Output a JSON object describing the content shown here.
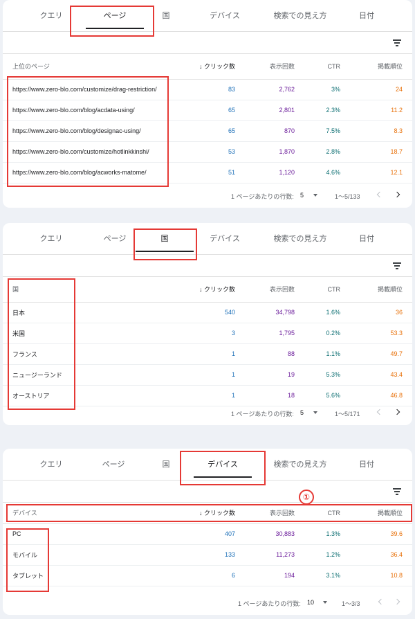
{
  "colors": {
    "accent_highlight": "#e53935",
    "clicks": "#1c6fb8",
    "impressions": "#6a1b9a",
    "ctr": "#0b6e72",
    "position": "#e8710a"
  },
  "panels": [
    {
      "tabs": [
        "クエリ",
        "ページ",
        "国",
        "デバイス",
        "検索での見え方",
        "日付"
      ],
      "active_tab": 1,
      "columns": [
        "上位のページ",
        "クリック数",
        "表示回数",
        "CTR",
        "掲載順位"
      ],
      "rows": [
        [
          "https://www.zero-blo.com/customize/drag-restriction/",
          "83",
          "2,762",
          "3%",
          "24"
        ],
        [
          "https://www.zero-blo.com/blog/acdata-using/",
          "65",
          "2,801",
          "2.3%",
          "11.2"
        ],
        [
          "https://www.zero-blo.com/blog/designac-using/",
          "65",
          "870",
          "7.5%",
          "8.3"
        ],
        [
          "https://www.zero-blo.com/customize/hotlinkkinshi/",
          "53",
          "1,870",
          "2.8%",
          "18.7"
        ],
        [
          "https://www.zero-blo.com/blog/acworks-matome/",
          "51",
          "1,120",
          "4.6%",
          "12.1"
        ]
      ],
      "pager": {
        "rows_label": "1 ページあたりの行数:",
        "rows_value": "5",
        "range": "1〜5/133"
      }
    },
    {
      "tabs": [
        "クエリ",
        "ページ",
        "国",
        "デバイス",
        "検索での見え方",
        "日付"
      ],
      "active_tab": 2,
      "columns": [
        "国",
        "クリック数",
        "表示回数",
        "CTR",
        "掲載順位"
      ],
      "rows": [
        [
          "日本",
          "540",
          "34,798",
          "1.6%",
          "36"
        ],
        [
          "米国",
          "3",
          "1,795",
          "0.2%",
          "53.3"
        ],
        [
          "フランス",
          "1",
          "88",
          "1.1%",
          "49.7"
        ],
        [
          "ニュージーランド",
          "1",
          "19",
          "5.3%",
          "43.4"
        ],
        [
          "オーストリア",
          "1",
          "18",
          "5.6%",
          "46.8"
        ]
      ],
      "pager": {
        "rows_label": "1 ページあたりの行数:",
        "rows_value": "5",
        "range": "1〜5/171"
      }
    },
    {
      "tabs": [
        "クエリ",
        "ページ",
        "国",
        "デバイス",
        "検索での見え方",
        "日付"
      ],
      "active_tab": 3,
      "columns": [
        "デバイス",
        "クリック数",
        "表示回数",
        "CTR",
        "掲載順位"
      ],
      "rows": [
        [
          "PC",
          "407",
          "30,883",
          "1.3%",
          "39.6"
        ],
        [
          "モバイル",
          "133",
          "11,273",
          "1.2%",
          "36.4"
        ],
        [
          "タブレット",
          "6",
          "194",
          "3.1%",
          "10.8"
        ]
      ],
      "pager": {
        "rows_label": "1 ページあたりの行数:",
        "rows_value": "10",
        "range": "1〜3/3"
      }
    }
  ],
  "sort_arrow": "↓",
  "annotation_badge": "①"
}
